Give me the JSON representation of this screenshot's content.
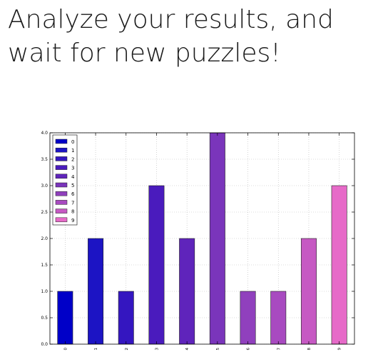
{
  "slide": {
    "title": "Analyze your results, and wait for new puzzles!"
  },
  "chart_data": {
    "type": "bar",
    "categories": [
      "0",
      "1",
      "2",
      "3",
      "4",
      "5",
      "6",
      "7",
      "8",
      "9"
    ],
    "values": [
      1,
      2,
      1,
      3,
      2,
      4,
      1,
      1,
      2,
      3
    ],
    "colors": [
      "#0000c8",
      "#1c14c4",
      "#3416c0",
      "#4a1bbd",
      "#5f24bb",
      "#7a35bb",
      "#9040bd",
      "#a84ac0",
      "#c659c3",
      "#e66ac8"
    ],
    "ylim": [
      0,
      4
    ],
    "yticks": [
      "0.0",
      "0.5",
      "1.0",
      "1.5",
      "2.0",
      "2.5",
      "3.0",
      "3.5",
      "4.0"
    ],
    "legend": {
      "placement": "top-left",
      "entries": [
        "0",
        "1",
        "2",
        "3",
        "4",
        "5",
        "6",
        "7",
        "8",
        "9"
      ]
    },
    "grid": true,
    "title": "",
    "xlabel": "",
    "ylabel": ""
  }
}
